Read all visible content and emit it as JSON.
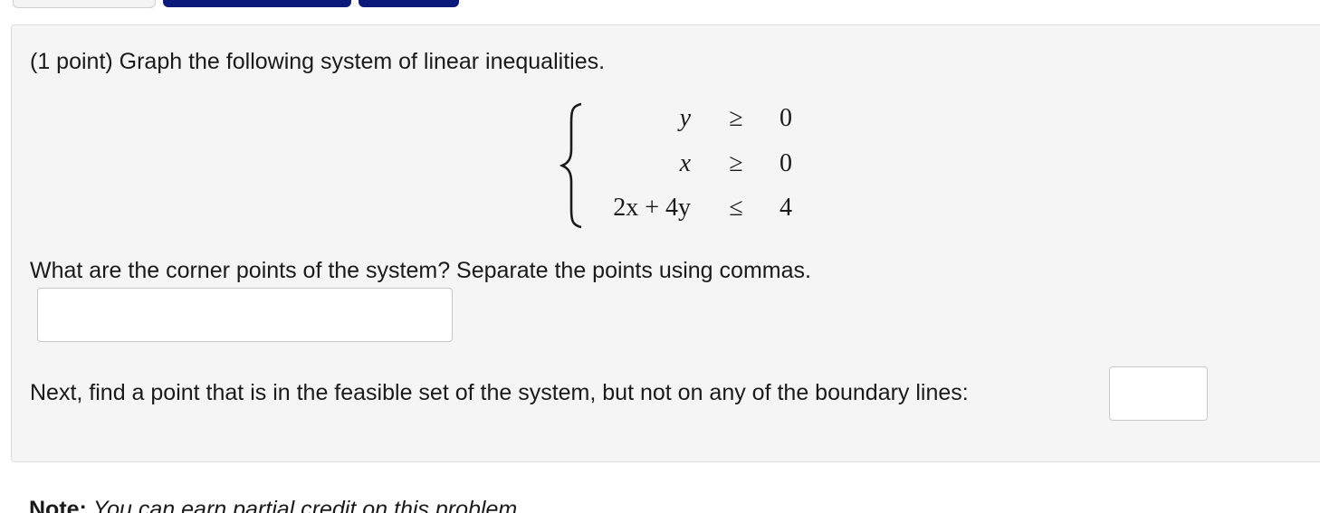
{
  "problem": {
    "instruction": "(1 point) Graph the following system of linear inequalities.",
    "system": [
      {
        "lhs": "y",
        "relation": "≥",
        "rhs": "0"
      },
      {
        "lhs": "x",
        "relation": "≥",
        "rhs": "0"
      },
      {
        "lhs": "2x + 4y",
        "relation": "≤",
        "rhs": "4"
      }
    ],
    "question_corner_points": "What are the corner points of the system? Separate the points using commas.",
    "corner_points_answer": "",
    "question_feasible_point": "Next, find a point that is in the feasible set of the system, but not on any of the boundary lines:",
    "feasible_point_answer": ""
  },
  "footer_note": {
    "label": "Note:",
    "text": "You can earn partial credit on this problem."
  },
  "colors": {
    "panel_background": "#f5f5f5",
    "button_dark": "#0b1a7a"
  }
}
